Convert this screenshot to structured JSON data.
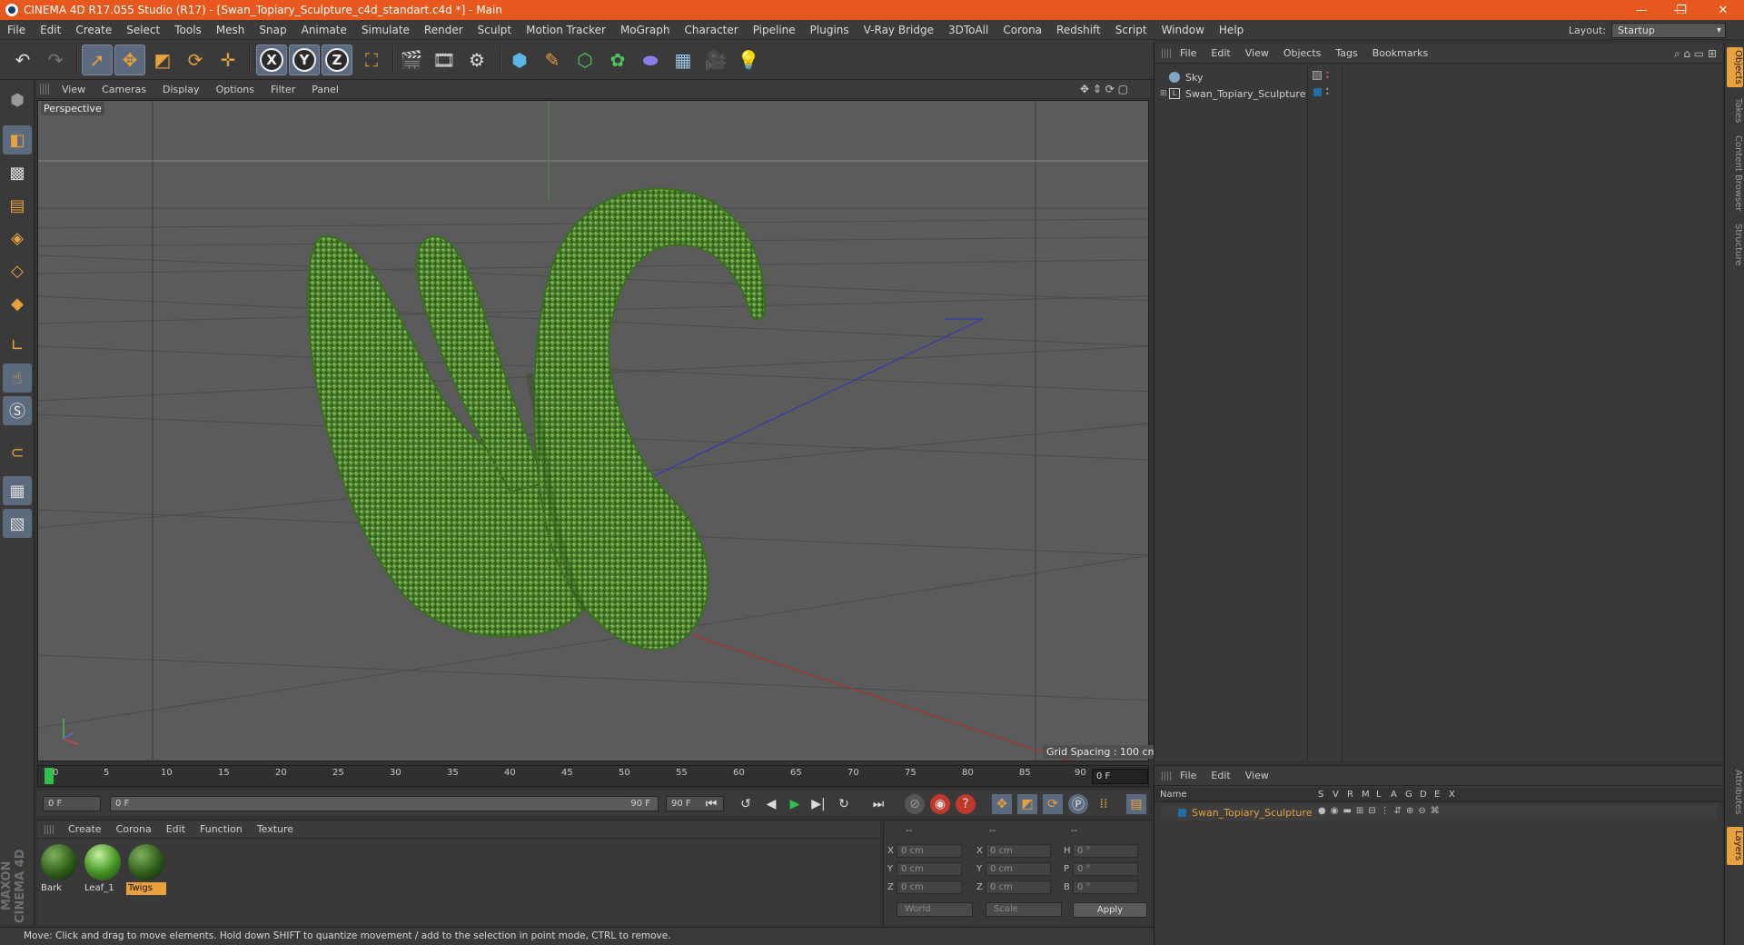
{
  "window": {
    "title": "CINEMA 4D R17.055 Studio (R17) - [Swan_Topiary_Sculpture_c4d_standart.c4d *] - Main",
    "minimize": "—",
    "restore": "❐",
    "close": "✕"
  },
  "menubar": {
    "items": [
      "File",
      "Edit",
      "Create",
      "Select",
      "Tools",
      "Mesh",
      "Snap",
      "Animate",
      "Simulate",
      "Render",
      "Sculpt",
      "Motion Tracker",
      "MoGraph",
      "Character",
      "Pipeline",
      "Plugins",
      "V-Ray Bridge",
      "3DToAll",
      "Corona",
      "Redshift",
      "Script",
      "Window",
      "Help"
    ],
    "layout_label": "Layout:",
    "layout_value": "Startup"
  },
  "toolbar": {
    "icons": [
      "undo-icon",
      "redo-icon",
      "select-icon",
      "move-icon",
      "scale-icon",
      "rotate-icon",
      "live-select-icon",
      "x-axis-icon",
      "y-axis-icon",
      "z-axis-icon",
      "coordinate-system-icon",
      "render-view-icon",
      "render-picture-viewer-icon",
      "edit-render-settings-icon",
      "cube-icon",
      "pen-icon",
      "subdivision-icon",
      "array-icon",
      "deformer-icon",
      "floor-icon",
      "camera-icon",
      "light-icon"
    ],
    "axis_x": "X",
    "axis_y": "Y",
    "axis_z": "Z"
  },
  "viewport": {
    "menu": [
      "View",
      "Cameras",
      "Display",
      "Options",
      "Filter",
      "Panel"
    ],
    "label": "Perspective",
    "grid_spacing": "Grid Spacing : 100 cm"
  },
  "timeline": {
    "ticks": [
      "0",
      "5",
      "10",
      "15",
      "20",
      "25",
      "30",
      "35",
      "40",
      "45",
      "50",
      "55",
      "60",
      "65",
      "70",
      "75",
      "80",
      "85",
      "90"
    ],
    "current_frame": "0 F",
    "start_field": "0 F",
    "range_start": "0 F",
    "range_end": "90 F",
    "end_field": "90 F"
  },
  "materials": {
    "menu": [
      "Create",
      "Corona",
      "Edit",
      "Function",
      "Texture"
    ],
    "items": [
      {
        "name": "Bark"
      },
      {
        "name": "Leaf_1"
      },
      {
        "name": "Twigs"
      }
    ]
  },
  "coordinates": {
    "header": [
      "--",
      "--",
      "--"
    ],
    "rows": [
      {
        "a": "X",
        "av": "0 cm",
        "b": "X",
        "bv": "0 cm",
        "c": "H",
        "cv": "0 °"
      },
      {
        "a": "Y",
        "av": "0 cm",
        "b": "Y",
        "bv": "0 cm",
        "c": "P",
        "cv": "0 °"
      },
      {
        "a": "Z",
        "av": "0 cm",
        "b": "Z",
        "bv": "0 cm",
        "c": "B",
        "cv": "0 °"
      }
    ],
    "world": "World",
    "scale": "Scale",
    "apply": "Apply"
  },
  "status": {
    "text": "Move: Click and drag to move elements. Hold down SHIFT to quantize movement / add to the selection in point mode, CTRL to remove."
  },
  "brand": {
    "text": "MAXON CINEMA 4D"
  },
  "objects": {
    "menu": [
      "File",
      "Edit",
      "View",
      "Objects",
      "Tags",
      "Bookmarks"
    ],
    "items": [
      {
        "name": "Sky"
      },
      {
        "name": "Swan_Topiary_Sculpture"
      }
    ]
  },
  "layers": {
    "menu": [
      "File",
      "Edit",
      "View"
    ],
    "headers": {
      "name": "Name",
      "cols": [
        "S",
        "V",
        "R",
        "M",
        "L",
        "A",
        "G",
        "D",
        "E",
        "X"
      ]
    },
    "items": [
      {
        "name": "Swan_Topiary_Sculpture"
      }
    ]
  },
  "side_tabs": [
    "Objects",
    "Takes",
    "Content Browser",
    "Structure",
    "Attributes",
    "Layers"
  ],
  "colors": {
    "accent": "#e8a13b",
    "title": "#e8571d",
    "foliage": "#5f9b3a",
    "layer_color": "#1d6fa5",
    "playhead": "#2ec14b"
  }
}
